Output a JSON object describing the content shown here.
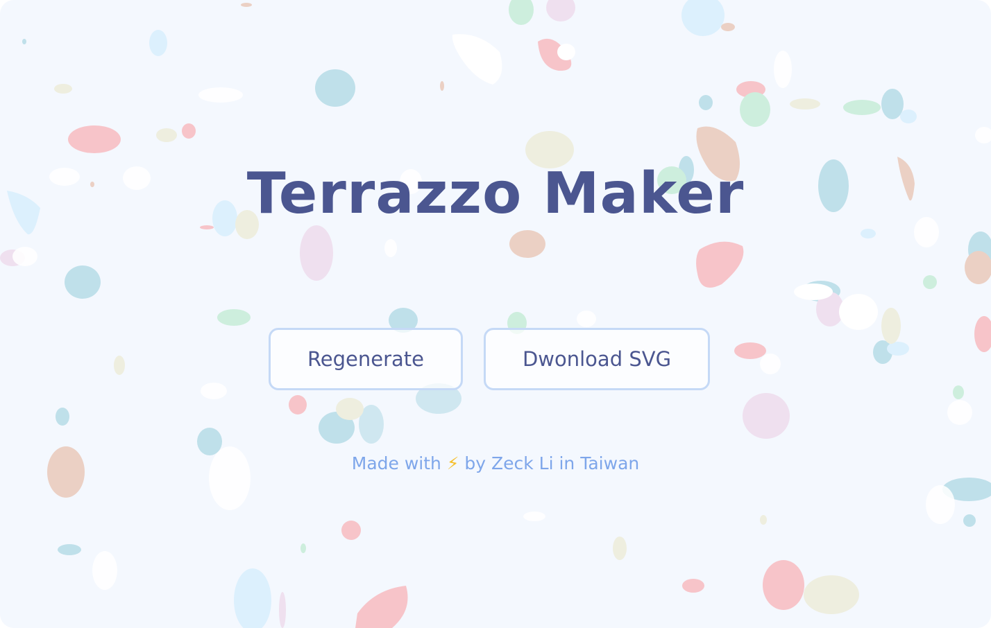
{
  "title": "Terrazzo Maker",
  "buttons": {
    "regenerate_label": "Regenerate",
    "download_label": "Dwonload SVG"
  },
  "footer": {
    "prefix": "Made with",
    "icon": "⚡",
    "suffix": "by Zeck Li in Taiwan"
  },
  "colors": {
    "background": "#f4f8fe",
    "title": "#4b5690",
    "button_border": "#c5d9f6",
    "footer_text": "#7ea6ea",
    "chip_palette": [
      "#f7c4c9",
      "#bfe0ea",
      "#dcf0fd",
      "#eeeedf",
      "#cdeedd",
      "#ebd0c4",
      "#efe0ef",
      "#ffffff"
    ]
  }
}
